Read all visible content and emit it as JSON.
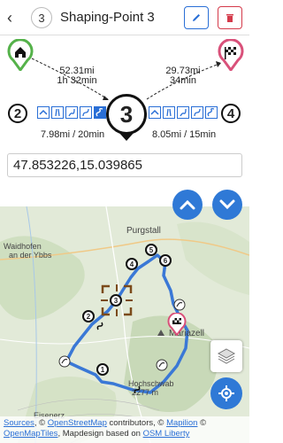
{
  "header": {
    "back_glyph": "‹",
    "index": "3",
    "title": "Shaping-Point 3"
  },
  "prev": {
    "total_distance": "52.31mi",
    "total_time": "1h 32min",
    "point_number": "2",
    "leg": "7.98mi / 20min"
  },
  "current": {
    "number": "3"
  },
  "next": {
    "total_distance": "29.73mi",
    "total_time": "34min",
    "point_number": "4",
    "leg": "8.05mi / 15min"
  },
  "coords": {
    "value": "47.853226,15.039865"
  },
  "map": {
    "labels": {
      "purgstall": "Purgstall",
      "waidhofen_1": "Waidhofen",
      "waidhofen_2": "an der Ybbs",
      "mariazell": "Mariazell",
      "hochschwab": "Hochschwab",
      "elevation": "2277 m",
      "eisenerz": "Eisenerz"
    },
    "waypoints": [
      "1",
      "2",
      "3",
      "4",
      "5",
      "6"
    ],
    "route_color": "#3a78d6"
  },
  "attribution": {
    "sources": "Sources",
    "sep1": ", © ",
    "osm": "OpenStreetMap",
    "contributors": " contributors, © ",
    "mapilion": "Mapilion",
    "sep2": " © ",
    "omt": "OpenMapTiles",
    "design": ", Mapdesign based on ",
    "liberty": "OSM Liberty"
  },
  "colors": {
    "accent": "#2f79d6",
    "start": "#55b24a",
    "end": "#d9517a",
    "danger": "#d43a4a"
  }
}
